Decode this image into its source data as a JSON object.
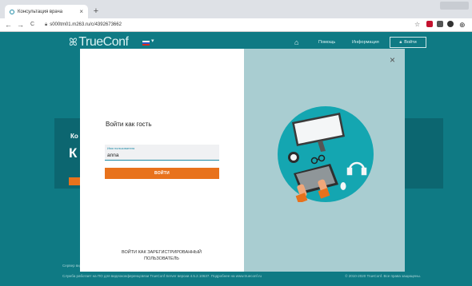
{
  "browser": {
    "tab_title": "Консультация врача",
    "tab_close": "×",
    "new_tab": "+",
    "back": "←",
    "forward": "→",
    "reload": "C",
    "url": "s000tm01.m263.ru/c/4392673662",
    "bookmark": "☆",
    "profile": "⊕"
  },
  "site": {
    "logo_text": "TrueConf",
    "language_chevron": "▾",
    "home_icon": "⌂",
    "nav_help": "Помощь",
    "nav_info": "Информация",
    "login_label": "Войти",
    "banner_small": "Ко",
    "banner_large": "К",
    "footer_line1": "Сервер видеосвязи последнего",
    "footer_line2": "Служба работает на ПО для видеоконференцсвязи TrueConf Server версии 4.5.2.10637. Подробнее на www.trueconf.ru",
    "footer_copyright": "© 2010-2020 TrueConf. Все права защищены."
  },
  "modal": {
    "close_label": "×",
    "title": "Войти как гость",
    "username_label": "Имя пользователя",
    "username_value": "anna",
    "enter_button": "ВОЙТИ",
    "registered_link": "ВОЙТИ КАК ЗАРЕГИСТРИРОВАННЫЙ ПОЛЬЗОВАТЕЛЬ"
  },
  "colors": {
    "site_bg": "#0f7a84",
    "accent_orange": "#e8721c",
    "illustration_circle": "#14a6b1",
    "modal_right_bg": "#a9cdd1"
  }
}
